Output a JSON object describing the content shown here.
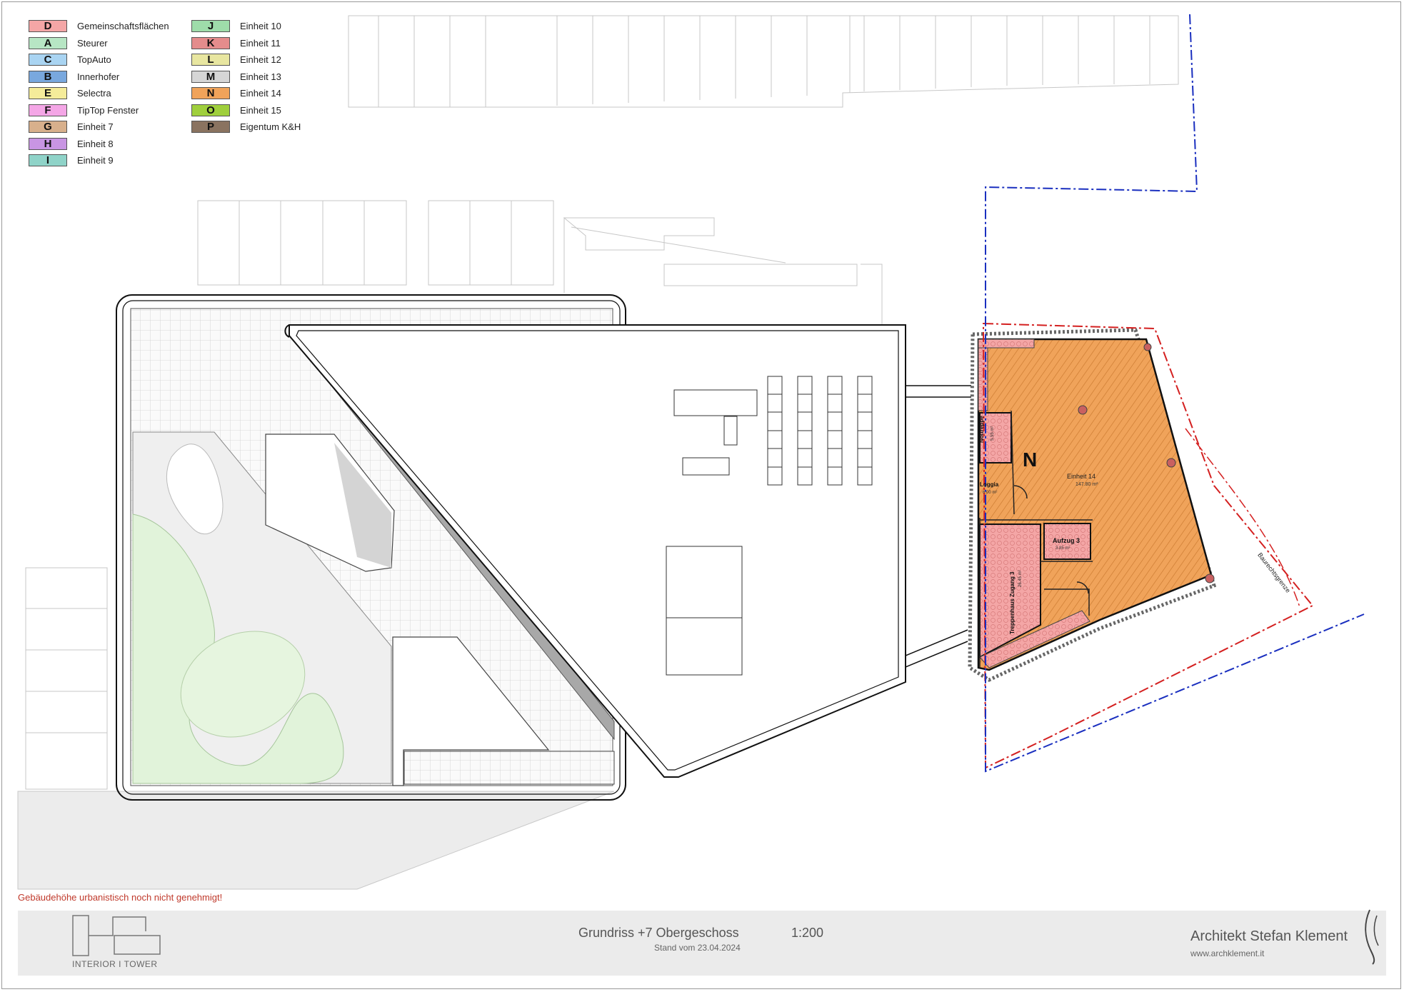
{
  "legend": [
    {
      "code": "D",
      "label": "Gemeinschaftsflächen",
      "color": "#f4a6a6"
    },
    {
      "code": "A",
      "label": "Steurer",
      "color": "#b7e6c4"
    },
    {
      "code": "C",
      "label": "TopAuto",
      "color": "#a9d4f2"
    },
    {
      "code": "B",
      "label": "Innerhofer",
      "color": "#79a8de"
    },
    {
      "code": "E",
      "label": "Selectra",
      "color": "#f5ec9a"
    },
    {
      "code": "F",
      "label": "TipTop Fenster",
      "color": "#f4a6e6"
    },
    {
      "code": "G",
      "label": "Einheit 7",
      "color": "#d8b08c"
    },
    {
      "code": "H",
      "label": "Einheit 8",
      "color": "#c895e3"
    },
    {
      "code": "I",
      "label": "Einheit 9",
      "color": "#8fd3c8"
    },
    {
      "code": "J",
      "label": "Einheit 10",
      "color": "#9edcaa"
    },
    {
      "code": "K",
      "label": "Einheit 11",
      "color": "#e48c8c"
    },
    {
      "code": "L",
      "label": "Einheit 12",
      "color": "#e8e6a0"
    },
    {
      "code": "M",
      "label": "Einheit 13",
      "color": "#d6d6d6"
    },
    {
      "code": "N",
      "label": "Einheit 14",
      "color": "#f0a35a"
    },
    {
      "code": "O",
      "label": "Einheit 15",
      "color": "#9fcf3c"
    },
    {
      "code": "P",
      "label": "Eigentum K&H",
      "color": "#8a7360"
    }
  ],
  "plan": {
    "unit_letter": "N",
    "unit_name": "Einheit 14",
    "unit_area": "147.80 m²",
    "notreppe_name": "Nottreppe",
    "notreppe_area": "5.55 m²",
    "loggia_name": "Loggia",
    "loggia_area": "6.00 m²",
    "stair_name": "Treppenhaus Zugang 3",
    "stair_area": "26.45 m²",
    "lift_name": "Aufzug 3",
    "lift_area": "3.85 m²",
    "boundary_label": "Baurechtsgrenze"
  },
  "warning": "Gebäudehöhe urbanistisch noch nicht genehmigt!",
  "titleblock": {
    "title": "Grundriss +7 Obergeschoss",
    "scale": "1:200",
    "date": "Stand vom 23.04.2024",
    "architect": "Architekt Stefan Klement",
    "website": "www.archklement.it",
    "project": "INTERIOR I TOWER"
  },
  "colors": {
    "unit_fill": "#f0a35a",
    "common_fill": "#f4a6a6",
    "boundary_red": "#d42020",
    "boundary_blue": "#1a2fbf",
    "warning_text": "#c0392b"
  }
}
